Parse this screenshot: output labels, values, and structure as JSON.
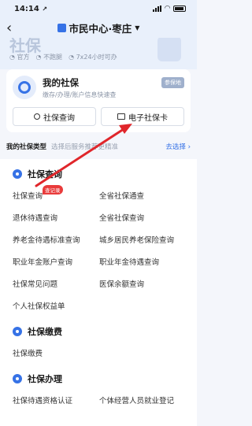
{
  "status": {
    "time": "14:14",
    "nav_arrow": "↗"
  },
  "nav": {
    "back_icon": "‹",
    "title": "市民中心·枣庄",
    "caret": "▼"
  },
  "hero": {
    "title": "社保",
    "tags": [
      "官方",
      "不跑腿",
      "7x24小时可办"
    ]
  },
  "card": {
    "title": "我的社保",
    "subtitle": "缴存/办理/账户信息快速查",
    "badge": "参保地",
    "btn_query": "社保查询",
    "btn_ecard": "电子社保卡"
  },
  "type_row": {
    "label": "我的社保类型",
    "hint": "选择后服务推荐更精准",
    "action": "去选择 ›"
  },
  "sections": [
    {
      "title": "社保查询",
      "items": [
        "社保查询",
        "全省社保通查",
        "退休待遇查询",
        "全省社保查询",
        "养老金待遇标准查询",
        "城乡居民养老保险查询",
        "职业年金账户查询",
        "职业年金待遇查询",
        "社保常见问题",
        "医保余额查询",
        "个人社保权益单"
      ],
      "badge": "查记录"
    },
    {
      "title": "社保缴费",
      "items": [
        "社保缴费"
      ]
    },
    {
      "title": "社保办理",
      "items": [
        "社保待遇资格认证",
        "个体经营人员就业登记"
      ]
    }
  ],
  "colors": {
    "accent": "#3672e6",
    "arrow": "#e0262b",
    "badge": "#e93b3b"
  }
}
